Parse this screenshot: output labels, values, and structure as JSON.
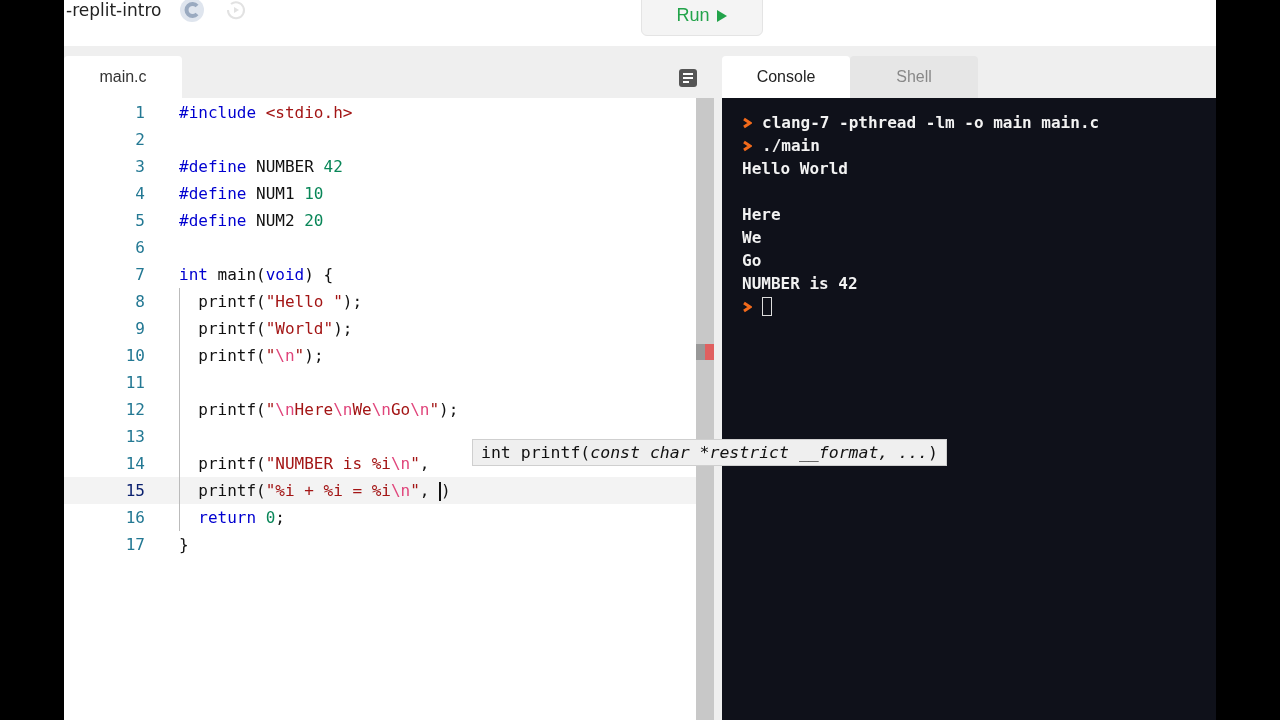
{
  "header": {
    "project": "-replit-intro",
    "run_label": "Run"
  },
  "editor": {
    "file_tab": {
      "label": "main.c",
      "selected": true
    },
    "lines": [
      {
        "n": "1",
        "active": false,
        "tokens": [
          {
            "kind": "kw",
            "text": "#include "
          },
          {
            "kind": "str",
            "text": "<stdio.h>"
          }
        ]
      },
      {
        "n": "2",
        "active": false
      },
      {
        "n": "3",
        "active": false,
        "tokens": [
          {
            "kind": "kw",
            "text": "#define"
          },
          {
            "kind": "plain",
            "text": " NUMBER "
          },
          {
            "kind": "num",
            "text": "42"
          }
        ]
      },
      {
        "n": "4",
        "active": false,
        "tokens": [
          {
            "kind": "kw",
            "text": "#define"
          },
          {
            "kind": "plain",
            "text": " NUM1 "
          },
          {
            "kind": "num",
            "text": "10"
          }
        ]
      },
      {
        "n": "5",
        "active": false,
        "tokens": [
          {
            "kind": "kw",
            "text": "#define"
          },
          {
            "kind": "plain",
            "text": " NUM2 "
          },
          {
            "kind": "num",
            "text": "20"
          }
        ]
      },
      {
        "n": "6",
        "active": false
      },
      {
        "n": "7",
        "active": false,
        "tokens": [
          {
            "kind": "kw",
            "text": "int"
          },
          {
            "kind": "plain",
            "text": " main("
          },
          {
            "kind": "kw",
            "text": "void"
          },
          {
            "kind": "plain",
            "text": ") {"
          }
        ]
      },
      {
        "n": "8",
        "active": false,
        "tokens": [
          {
            "kind": "plain",
            "text": "  printf("
          },
          {
            "kind": "str",
            "text": "\"Hello \""
          },
          {
            "kind": "plain",
            "text": ");"
          }
        ]
      },
      {
        "n": "9",
        "active": false,
        "tokens": [
          {
            "kind": "plain",
            "text": "  printf("
          },
          {
            "kind": "str",
            "text": "\"World\""
          },
          {
            "kind": "plain",
            "text": ");"
          }
        ]
      },
      {
        "n": "10",
        "active": false,
        "tokens": [
          {
            "kind": "plain",
            "text": "  printf("
          },
          {
            "kind": "str",
            "text": "\""
          },
          {
            "kind": "esc",
            "text": "\\n"
          },
          {
            "kind": "str",
            "text": "\""
          },
          {
            "kind": "plain",
            "text": ");"
          }
        ]
      },
      {
        "n": "11",
        "active": false
      },
      {
        "n": "12",
        "active": false,
        "tokens": [
          {
            "kind": "plain",
            "text": "  printf("
          },
          {
            "kind": "str",
            "text": "\""
          },
          {
            "kind": "esc",
            "text": "\\n"
          },
          {
            "kind": "str",
            "text": "Here"
          },
          {
            "kind": "esc",
            "text": "\\n"
          },
          {
            "kind": "str",
            "text": "We"
          },
          {
            "kind": "esc",
            "text": "\\n"
          },
          {
            "kind": "str",
            "text": "Go"
          },
          {
            "kind": "esc",
            "text": "\\n"
          },
          {
            "kind": "str",
            "text": "\""
          },
          {
            "kind": "plain",
            "text": ");"
          }
        ]
      },
      {
        "n": "13",
        "active": false
      },
      {
        "n": "14",
        "active": false,
        "tokens": [
          {
            "kind": "plain",
            "text": "  printf("
          },
          {
            "kind": "str",
            "text": "\"NUMBER is %i"
          },
          {
            "kind": "esc",
            "text": "\\n"
          },
          {
            "kind": "str",
            "text": "\""
          },
          {
            "kind": "plain",
            "text": ","
          }
        ]
      },
      {
        "n": "15",
        "active": true,
        "tokens": [
          {
            "kind": "plain",
            "text": "  printf("
          },
          {
            "kind": "str",
            "text": "\"%i + %i = %i"
          },
          {
            "kind": "esc",
            "text": "\\n"
          },
          {
            "kind": "str",
            "text": "\""
          },
          {
            "kind": "plain",
            "text": ", "
          },
          {
            "kind": "cursor"
          },
          {
            "kind": "plain",
            "text": ")"
          }
        ]
      },
      {
        "n": "16",
        "active": false,
        "tokens": [
          {
            "kind": "kw",
            "text": "  return"
          },
          {
            "kind": "num",
            "text": " 0"
          },
          {
            "kind": "plain",
            "text": ";"
          }
        ]
      },
      {
        "n": "17",
        "active": false,
        "tokens": [
          {
            "kind": "plain",
            "text": "}"
          }
        ]
      }
    ],
    "tooltip": {
      "plain": "int printf(",
      "italic": "const char *restrict __format, ...",
      "close": ")"
    }
  },
  "console": {
    "tabs": [
      {
        "label": "Console",
        "selected": true
      },
      {
        "label": "Shell",
        "selected": false
      }
    ],
    "lines": [
      {
        "kind": "prompt",
        "text": "clang-7 -pthread -lm -o main main.c"
      },
      {
        "kind": "prompt",
        "text": "./main"
      },
      {
        "kind": "output",
        "text": "Hello World"
      },
      {
        "kind": "blank"
      },
      {
        "kind": "output",
        "text": "Here"
      },
      {
        "kind": "output",
        "text": "We"
      },
      {
        "kind": "output",
        "text": "Go"
      },
      {
        "kind": "output",
        "text": "NUMBER is 42"
      },
      {
        "kind": "input"
      }
    ]
  }
}
